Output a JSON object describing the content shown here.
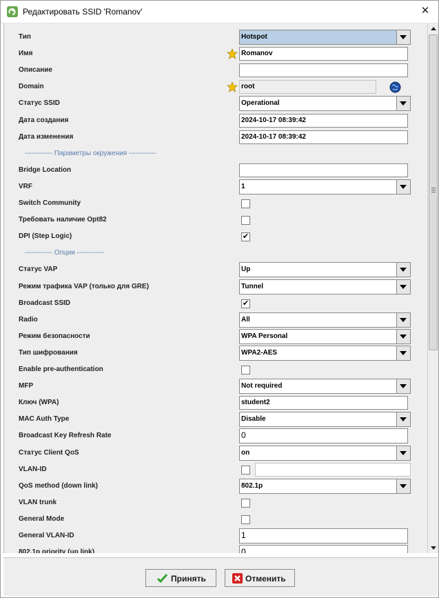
{
  "window": {
    "title": "Редактировать SSID 'Romanov'",
    "close": "✕"
  },
  "rows": [
    {
      "kind": "combo",
      "label": "Тип",
      "value": "Hotspot",
      "selected": true
    },
    {
      "kind": "text",
      "label": "Имя",
      "value": "Romanov",
      "star": true
    },
    {
      "kind": "text",
      "label": "Описание",
      "value": ""
    },
    {
      "kind": "readonly",
      "label": "Domain",
      "value": "root",
      "star": true,
      "globe": true
    },
    {
      "kind": "combo",
      "label": "Статус SSID",
      "value": "Operational"
    },
    {
      "kind": "text",
      "label": "Дата создания",
      "value": "2024-10-17 08:39:42"
    },
    {
      "kind": "text",
      "label": "Дата изменения",
      "value": "2024-10-17 08:39:42"
    },
    {
      "kind": "section",
      "label": "------------ Параметры окружения ------------"
    },
    {
      "kind": "text",
      "label": "Bridge Location",
      "value": ""
    },
    {
      "kind": "combo",
      "label": "VRF",
      "value": "1"
    },
    {
      "kind": "check",
      "label": "Switch Community",
      "checked": false
    },
    {
      "kind": "check",
      "label": "Требовать наличие Opt82",
      "checked": false
    },
    {
      "kind": "check",
      "label": "DPI (Step Logic)",
      "checked": true
    },
    {
      "kind": "section",
      "label": "------------ Опции ------------"
    },
    {
      "kind": "combo",
      "label": "Статус VAP",
      "value": "Up"
    },
    {
      "kind": "combo",
      "label": "Режим трафика VAP (только для GRE)",
      "value": "Tunnel"
    },
    {
      "kind": "check",
      "label": "Broadcast SSID",
      "checked": true
    },
    {
      "kind": "combo",
      "label": "Radio",
      "value": "All"
    },
    {
      "kind": "combo",
      "label": "Режим безопасности",
      "value": "WPA Personal"
    },
    {
      "kind": "combo",
      "label": "Тип шифрования",
      "value": "WPA2-AES"
    },
    {
      "kind": "check",
      "label": "Enable pre-authentication",
      "checked": false
    },
    {
      "kind": "combo",
      "label": "MFP",
      "value": "Not required"
    },
    {
      "kind": "text",
      "label": "Ключ (WPA)",
      "value": "student2"
    },
    {
      "kind": "combo",
      "label": "MAC Auth Type",
      "value": "Disable"
    },
    {
      "kind": "textbig",
      "label": "Broadcast Key Refresh Rate",
      "value": "0"
    },
    {
      "kind": "combo",
      "label": "Статус Client QoS",
      "value": "on"
    },
    {
      "kind": "checkfield",
      "label": "VLAN-ID",
      "checked": false,
      "value": ""
    },
    {
      "kind": "combo",
      "label": "QoS method (down link)",
      "value": "802.1p"
    },
    {
      "kind": "check",
      "label": "VLAN trunk",
      "checked": false
    },
    {
      "kind": "check",
      "label": "General Mode",
      "checked": false
    },
    {
      "kind": "textbig",
      "label": "General VLAN-ID",
      "value": "1"
    },
    {
      "kind": "textbig",
      "label": "802.1p priority (up link)",
      "value": "0"
    }
  ],
  "buttons": {
    "ok": "Принять",
    "cancel": "Отменить"
  },
  "colors": {
    "section": "#5a7fae",
    "selected_combo": "#b8cfe5",
    "ok_icon": "#2fa52f",
    "cancel_icon": "#d42020"
  },
  "check_mark": "✔"
}
